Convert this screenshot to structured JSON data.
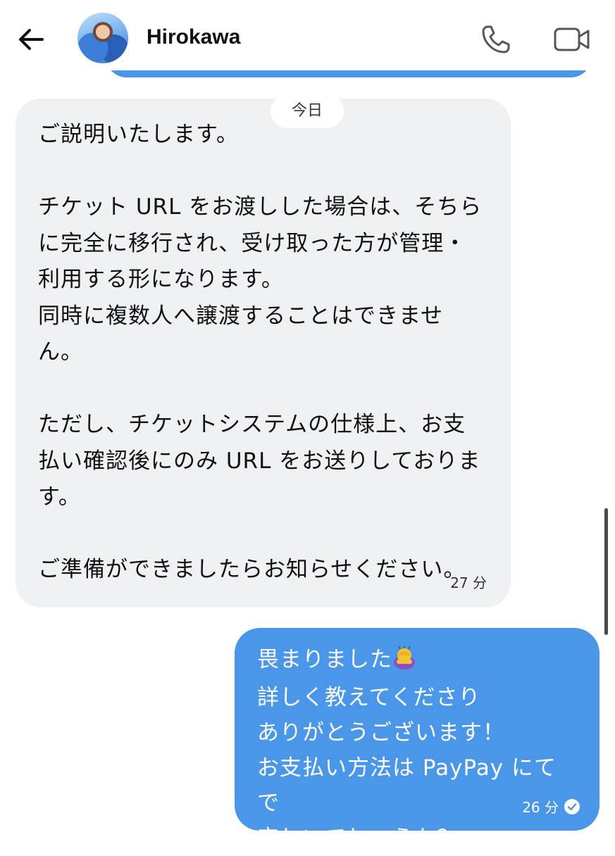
{
  "header": {
    "contact_name": "Hirokawa",
    "back_icon": "arrow-left-icon",
    "call_icon": "phone-icon",
    "video_icon": "video-camera-icon"
  },
  "date_separator": "今日",
  "messages": [
    {
      "direction": "incoming",
      "text": "ご説明いたします。\n\nチケット URL をお渡しした場合は、そちら\nに完全に移行され、受け取った方が管理・\n利用する形になります。\n同時に複数人へ譲渡することはできませ\nん。\n\nただし、チケットシステムの仕様上、お支\n払い確認後にのみ URL をお送りしておりま\nす。\n\nご準備ができましたらお知らせください。",
      "time": "27 分"
    },
    {
      "direction": "outgoing",
      "line1": "畏まりました",
      "emoji": "person-bowing-emoji",
      "rest": "詳しく教えてくださり\nありがとうございます！\nお支払い方法は PayPay にてで\n宜しいでしょうか？",
      "time": "26 分",
      "status_icon": "read-check-icon"
    }
  ],
  "colors": {
    "outgoing_bubble": "#4a96e8",
    "incoming_bubble": "#eff2f5",
    "background": "#ffffff"
  }
}
